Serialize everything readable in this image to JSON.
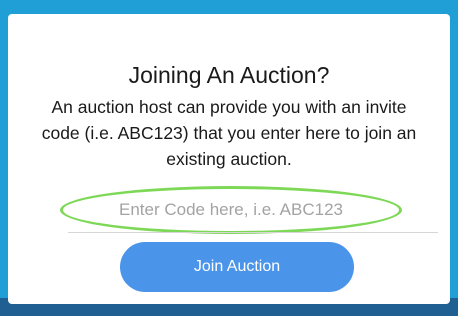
{
  "dialog": {
    "title": "Joining An Auction?",
    "description": "An auction host can provide you with an invite code (i.e. ABC123) that you enter here to join an existing auction.",
    "code_input": {
      "value": "",
      "placeholder": "Enter Code here, i.e. ABC123"
    },
    "join_button_label": "Join Auction"
  },
  "colors": {
    "background": "#1f9fd6",
    "card": "#ffffff",
    "button": "#4a94ea",
    "highlight_ring": "#7ed857"
  }
}
